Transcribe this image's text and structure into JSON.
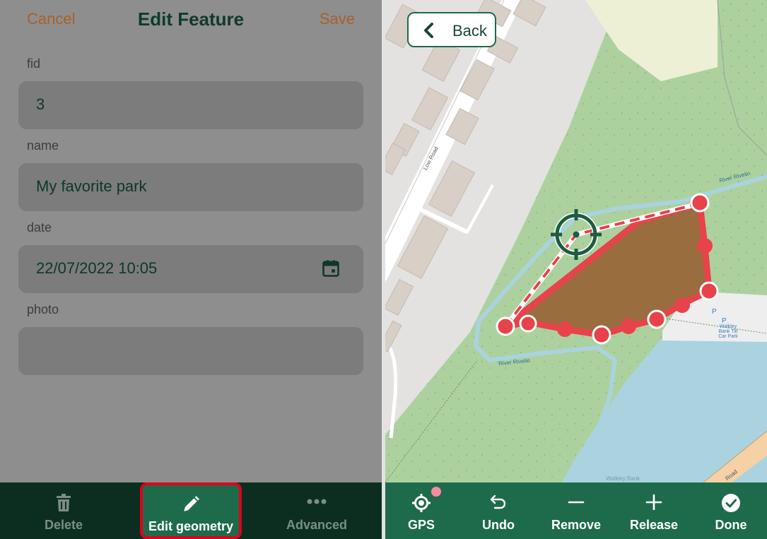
{
  "form": {
    "header": {
      "cancel_label": "Cancel",
      "title": "Edit Feature",
      "save_label": "Save"
    },
    "fields": [
      {
        "label": "fid",
        "value": "3"
      },
      {
        "label": "name",
        "value": "My favorite park"
      },
      {
        "label": "date",
        "value": "22/07/2022 10:05",
        "icon": "calendar-icon"
      },
      {
        "label": "photo",
        "value": ""
      }
    ],
    "toolbar": {
      "delete_label": "Delete",
      "edit_geometry_label": "Edit geometry",
      "advanced_label": "Advanced"
    }
  },
  "map": {
    "back_label": "Back",
    "labels": {
      "road": "Low Road",
      "river_top": "River Rivelin",
      "river_bottom": "River Rivelin",
      "car_park": "Walkley Bank Tilt Car Park",
      "parking_1": "P",
      "parking_2": "P",
      "water": "Walkley Bank",
      "road_bottom": "Road"
    },
    "toolbar": {
      "gps_label": "GPS",
      "undo_label": "Undo",
      "remove_label": "Remove",
      "release_label": "Release",
      "done_label": "Done"
    }
  },
  "colors": {
    "accent_green": "#1e6b4c",
    "dark_green": "#0c2e21",
    "cancel_save": "#a9602a",
    "highlight": "#e1001a",
    "geometry_red": "#e8424a",
    "polygon_fill": "#9a6d3f",
    "gps_badge": "#f58ca1"
  }
}
